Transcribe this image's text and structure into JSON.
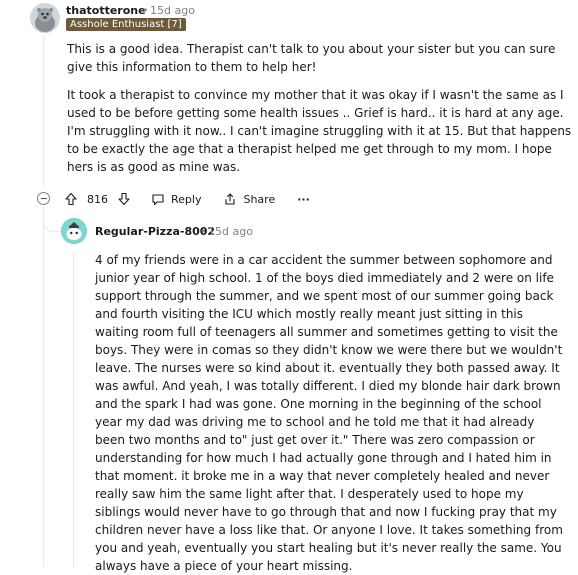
{
  "parent_comment": {
    "username": "thatotterone",
    "separator": "•",
    "time": "15d ago",
    "flair": "Asshole Enthusiast [7]",
    "paragraphs": [
      "This is a good idea. Therapist can't talk to you about your sister but you can sure give this information to them to help her!",
      "It took a therapist to convince my mother that it was okay if I wasn't the same as I used to be before getting some health issues .. Grief is hard.. it is hard at any age. I'm struggling with it now.. I can't imagine struggling with it at 15. But that happens to be exactly the age that a therapist helped me get through to my mom. I hope hers is as good as mine was."
    ],
    "actions": {
      "upvotes": "816",
      "reply_label": "Reply",
      "share_label": "Share",
      "more_label": "···"
    }
  },
  "reply_comment": {
    "username": "Regular-Pizza-8002",
    "separator": "•",
    "time": "15d ago",
    "body": "4 of my friends were in a car accident the summer between sophomore and junior year of high school. 1 of the boys died immediately and 2 were on life support through the summer, and we spent most of our summer going back and fourth visiting the ICU which mostly really meant just sitting in this waiting room full of teenagers all summer and sometimes getting to visit the boys. They were in comas so they didn't know we were there but we wouldn't leave. The nurses were so kind about it. eventually they both passed away. It was awful. And yeah, I was totally different. I died my blonde hair dark brown and the spark I had was gone. One morning in the beginning of the school year my dad was driving me to school and he told me that it had already been two months and to\" just get over it.\" There was zero compassion or understanding for how much I had actually gone through and I hated him in that moment. it broke me in a way that never completely healed and never really saw him the same light after that. I desperately used to hope my siblings would never have to go through that and now I fucking pray that my children never have a loss like that. Or anyone I love. It takes something from you and yeah, eventually you start healing but it's never really the same. You always have a piece of your heart missing."
  },
  "colors": {
    "flair_bg": "#6e5a3a",
    "meta": "#7c8387",
    "thread_line": "#e6e8ea"
  }
}
